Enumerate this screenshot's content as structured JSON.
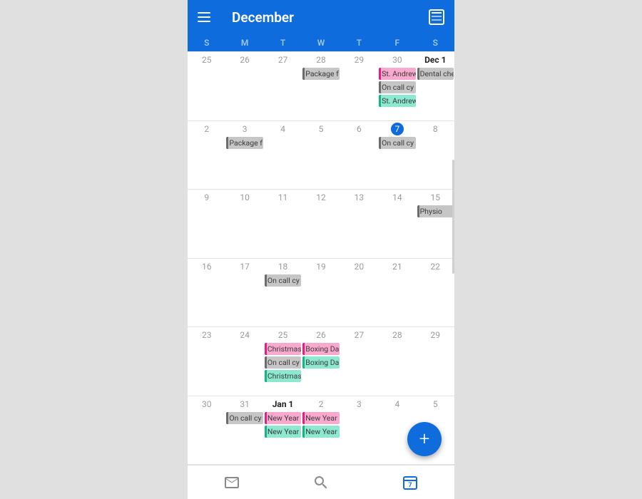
{
  "appbar": {
    "title": "December"
  },
  "dow": [
    "S",
    "M",
    "T",
    "W",
    "T",
    "F",
    "S"
  ],
  "today_day_number": "7",
  "weeks": [
    {
      "cells": [
        {
          "num": "25",
          "events": []
        },
        {
          "num": "26",
          "events": []
        },
        {
          "num": "27",
          "events": []
        },
        {
          "num": "28",
          "events": [
            {
              "label": "Package f",
              "color": "gray"
            }
          ]
        },
        {
          "num": "29",
          "events": []
        },
        {
          "num": "30",
          "events": [
            {
              "label": "St. Andrew",
              "color": "pink"
            },
            {
              "label": "On call cy",
              "color": "gray"
            },
            {
              "label": "St. Andrew",
              "color": "teal"
            }
          ]
        },
        {
          "num": "Dec 1",
          "firstday": true,
          "events": [
            {
              "label": "Dental che",
              "color": "gray"
            }
          ]
        }
      ]
    },
    {
      "cells": [
        {
          "num": "2",
          "events": []
        },
        {
          "num": "3",
          "events": [
            {
              "label": "Package f",
              "color": "gray"
            }
          ]
        },
        {
          "num": "4",
          "events": []
        },
        {
          "num": "5",
          "events": []
        },
        {
          "num": "6",
          "events": []
        },
        {
          "num": "7",
          "today": true,
          "events": [
            {
              "label": "On call cy",
              "color": "gray"
            }
          ]
        },
        {
          "num": "8",
          "events": []
        }
      ]
    },
    {
      "cells": [
        {
          "num": "9",
          "events": []
        },
        {
          "num": "10",
          "events": []
        },
        {
          "num": "11",
          "events": []
        },
        {
          "num": "12",
          "events": []
        },
        {
          "num": "13",
          "events": []
        },
        {
          "num": "14",
          "events": []
        },
        {
          "num": "15",
          "events": [
            {
              "label": "Physio",
              "color": "gray"
            }
          ]
        }
      ]
    },
    {
      "cells": [
        {
          "num": "16",
          "events": []
        },
        {
          "num": "17",
          "events": []
        },
        {
          "num": "18",
          "events": [
            {
              "label": "On call cy",
              "color": "gray"
            }
          ]
        },
        {
          "num": "19",
          "events": []
        },
        {
          "num": "20",
          "events": []
        },
        {
          "num": "21",
          "events": []
        },
        {
          "num": "22",
          "events": []
        }
      ]
    },
    {
      "cells": [
        {
          "num": "23",
          "events": []
        },
        {
          "num": "24",
          "events": []
        },
        {
          "num": "25",
          "events": [
            {
              "label": "Christmas",
              "color": "pink"
            },
            {
              "label": "On call cy",
              "color": "gray"
            },
            {
              "label": "Christmas",
              "color": "teal"
            }
          ]
        },
        {
          "num": "26",
          "events": [
            {
              "label": "Boxing Da",
              "color": "pink"
            },
            {
              "label": "Boxing Da",
              "color": "teal"
            }
          ]
        },
        {
          "num": "27",
          "events": []
        },
        {
          "num": "28",
          "events": []
        },
        {
          "num": "29",
          "events": []
        }
      ]
    },
    {
      "cells": [
        {
          "num": "30",
          "events": []
        },
        {
          "num": "31",
          "events": [
            {
              "label": "On call cy",
              "color": "gray"
            }
          ]
        },
        {
          "num": "Jan 1",
          "firstday": true,
          "events": [
            {
              "label": "New Year",
              "color": "pink"
            },
            {
              "label": "New Year",
              "color": "teal"
            }
          ]
        },
        {
          "num": "2",
          "events": [
            {
              "label": "New Year",
              "color": "pink"
            },
            {
              "label": "New Year",
              "color": "teal"
            }
          ]
        },
        {
          "num": "3",
          "events": []
        },
        {
          "num": "4",
          "events": []
        },
        {
          "num": "5",
          "events": []
        }
      ]
    }
  ],
  "bottom": {
    "mail_icon": "mail",
    "search_icon": "search",
    "calendar_icon": "calendar"
  }
}
